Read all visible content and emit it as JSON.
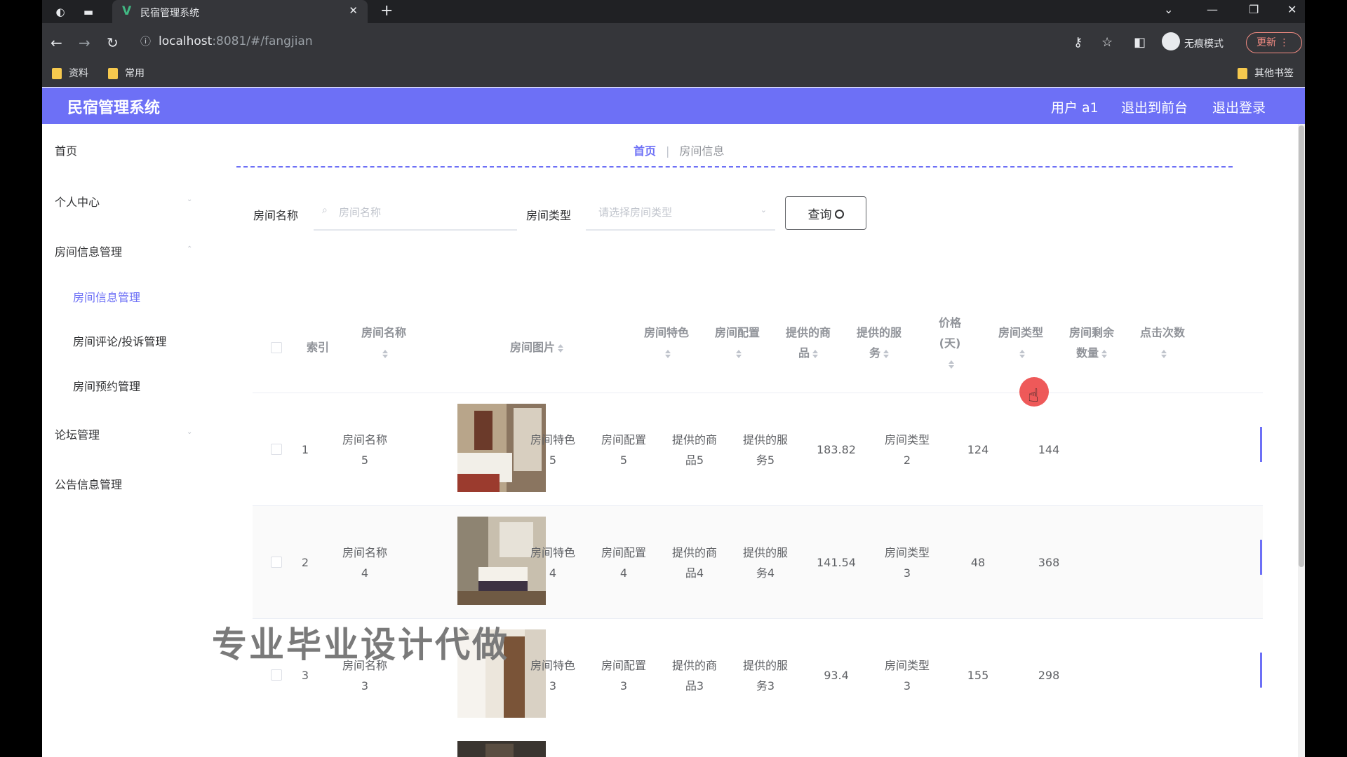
{
  "browser": {
    "tab_title": "民宿管理系统",
    "url_host": "localhost",
    "url_path": ":8081/#/fangjian",
    "incognito_label": "无痕模式",
    "update_label": "更新",
    "bookmarks": [
      "资料",
      "常用"
    ],
    "other_bookmarks": "其他书签"
  },
  "header": {
    "title": "民宿管理系统",
    "user": "用户 a1",
    "to_front": "退出到前台",
    "logout": "退出登录"
  },
  "sidebar": {
    "items": [
      {
        "label": "首页"
      },
      {
        "label": "个人中心"
      },
      {
        "label": "房间信息管理"
      },
      {
        "label": "论坛管理"
      },
      {
        "label": "公告信息管理"
      }
    ],
    "sub_items": [
      {
        "label": "房间信息管理",
        "active": true
      },
      {
        "label": "房间评论/投诉管理",
        "active": false
      },
      {
        "label": "房间预约管理",
        "active": false
      }
    ]
  },
  "breadcrumb": {
    "home": "首页",
    "current": "房间信息"
  },
  "search": {
    "name_label": "房间名称",
    "name_placeholder": "房间名称",
    "type_label": "房间类型",
    "type_placeholder": "请选择房间类型",
    "query_button": "查询"
  },
  "table": {
    "headers": {
      "index": "索引",
      "name": [
        "房间名称"
      ],
      "photo": "房间图片",
      "feature": [
        "房间特色"
      ],
      "config": [
        "房间配置"
      ],
      "goods": [
        "提供的商",
        "品"
      ],
      "service": [
        "提供的服",
        "务"
      ],
      "price": [
        "价格",
        "(天)"
      ],
      "type": [
        "房间类型"
      ],
      "remaining": [
        "房间剩余",
        "数量"
      ],
      "clicks": [
        "点击次数"
      ]
    },
    "rows": [
      {
        "index": "1",
        "name": [
          "房间名称",
          "5"
        ],
        "feature": [
          "房间特色",
          "5"
        ],
        "config": [
          "房间配置",
          "5"
        ],
        "goods": [
          "提供的商",
          "品5"
        ],
        "service": [
          "提供的服",
          "务5"
        ],
        "price": "183.82",
        "type": [
          "房间类型",
          "2"
        ],
        "remaining": "124",
        "clicks": "144"
      },
      {
        "index": "2",
        "name": [
          "房间名称",
          "4"
        ],
        "feature": [
          "房间特色",
          "4"
        ],
        "config": [
          "房间配置",
          "4"
        ],
        "goods": [
          "提供的商",
          "品4"
        ],
        "service": [
          "提供的服",
          "务4"
        ],
        "price": "141.54",
        "type": [
          "房间类型",
          "3"
        ],
        "remaining": "48",
        "clicks": "368"
      },
      {
        "index": "3",
        "name": [
          "房间名称",
          "3"
        ],
        "feature": [
          "房间特色",
          "3"
        ],
        "config": [
          "房间配置",
          "3"
        ],
        "goods": [
          "提供的商",
          "品3"
        ],
        "service": [
          "提供的服",
          "务3"
        ],
        "price": "93.4",
        "type": [
          "房间类型",
          "3"
        ],
        "remaining": "155",
        "clicks": "298"
      }
    ]
  },
  "watermark": "专业毕业设计代做",
  "colors": {
    "accent": "#6d70f6",
    "header_bg": "#6d70f6"
  }
}
